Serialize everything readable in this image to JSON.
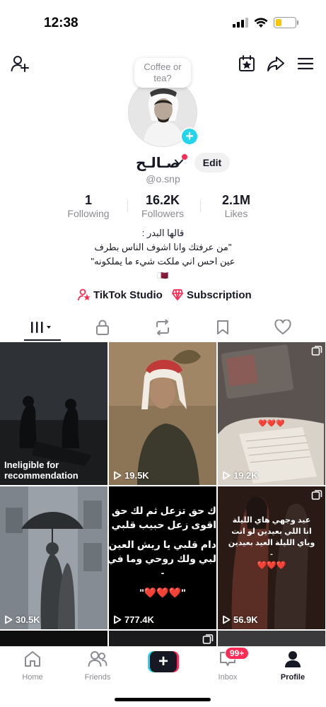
{
  "status_bar": {
    "time": "12:38"
  },
  "note": {
    "text_line1": "Coffee or",
    "text_line2": "tea?"
  },
  "profile": {
    "display_name": "صـالـح",
    "username": "@o.snp",
    "edit_label": "Edit"
  },
  "stats": [
    {
      "value": "1",
      "label": "Following"
    },
    {
      "value": "16.2K",
      "label": "Followers"
    },
    {
      "value": "2.1M",
      "label": "Likes"
    }
  ],
  "bio": {
    "line1": "قالها البدر :",
    "line2": "\"من عرفتك وانا اشوف الناس بطرف",
    "line3": "عين احس اني ملكت شيء ما يملكونه\"",
    "line4": "🇶🇦"
  },
  "links": {
    "studio": "TikTok Studio",
    "subscription": "Subscription"
  },
  "videos": [
    {
      "label_line1": "Ineligible for",
      "label_line2": "recommendation"
    },
    {
      "views": "19.5K"
    },
    {
      "views": "19.2K",
      "overlay_text": "❤️❤️❤️"
    },
    {
      "views": "30.5K"
    },
    {
      "views": "777.4K",
      "overlay_lines": [
        "ك حق تزعل ثم لك حق نرضيك",
        "اقوى زعل حبيب قلبي وعينه",
        "دام قلبي يا ريش العين مغلبك",
        "لبي ولك روحي وما في يدينه",
        "-",
        "\"❤️❤️❤️\""
      ]
    },
    {
      "views": "56.9K",
      "overlay_lines": [
        "عيد وجهي هاي الليلة",
        "انا اللي بعيدين لو انت",
        "وياي الليلة العيد بعيدين",
        "-",
        "❤️❤️❤️"
      ]
    }
  ],
  "bottom_nav": {
    "home": "Home",
    "friends": "Friends",
    "inbox": "Inbox",
    "inbox_badge": "99+",
    "profile": "Profile"
  },
  "colors": {
    "accent_red": "#fe2c55",
    "accent_cyan": "#20d5ec",
    "text_primary": "#161823",
    "text_secondary": "#8a8b91"
  }
}
